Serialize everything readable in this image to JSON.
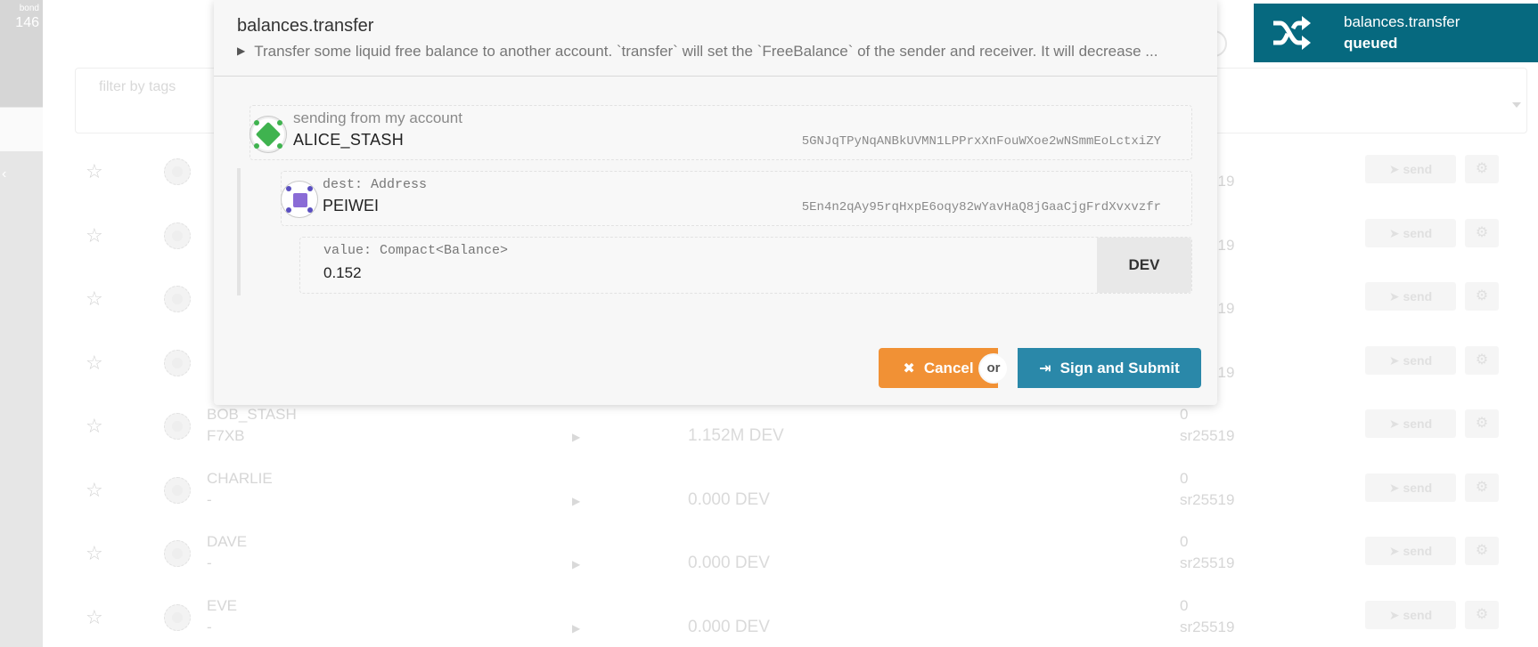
{
  "left_nav": {
    "top_small": "bond",
    "top_number": "146",
    "collapse_glyph": "‹"
  },
  "filter": {
    "placeholder": "filter by tags"
  },
  "accounts": [
    {
      "name": "",
      "address": "",
      "balance": "",
      "nonce": "",
      "crypto": "sr25519"
    },
    {
      "name": "",
      "address": "",
      "balance": "",
      "nonce": "",
      "crypto": "sr25519"
    },
    {
      "name": "",
      "address": "",
      "balance": "",
      "nonce": "",
      "crypto": "sr25519"
    },
    {
      "name": "",
      "address": "",
      "balance": "",
      "nonce": "",
      "crypto": "sr25519"
    },
    {
      "name": "BOB_STASH",
      "address": "F7XB",
      "balance": "1.152M DEV",
      "nonce": "0",
      "crypto": "sr25519"
    },
    {
      "name": "CHARLIE",
      "address": "-",
      "balance": "0.000 DEV",
      "nonce": "0",
      "crypto": "sr25519"
    },
    {
      "name": "DAVE",
      "address": "-",
      "balance": "0.000 DEV",
      "nonce": "0",
      "crypto": "sr25519"
    },
    {
      "name": "EVE",
      "address": "-",
      "balance": "0.000 DEV",
      "nonce": "0",
      "crypto": "sr25519"
    }
  ],
  "row_actions": {
    "send_label": "send"
  },
  "modal": {
    "title": "balances.transfer",
    "description": "Transfer some liquid free balance to another account. `transfer` will set the `FreeBalance` of the sender and receiver. It will decrease ...",
    "sender": {
      "label": "sending from my account",
      "name": "ALICE_STASH",
      "address": "5GNJqTPyNqANBkUVMN1LPPrxXnFouWXoe2wNSmmEoLctxiZY"
    },
    "dest": {
      "label": "dest: Address",
      "name": "PEIWEI",
      "address": "5En4n2qAy95rqHxpE6oqy82wYavHaQ8jGaaCjgFrdXvxvzfr"
    },
    "value": {
      "label": "value: Compact<Balance>",
      "amount": "0.152",
      "unit": "DEV"
    },
    "cancel_label": "Cancel",
    "or_label": "or",
    "submit_label": "Sign and Submit"
  },
  "toast": {
    "title": "balances.transfer",
    "status": "queued",
    "icon": "shuffle-icon",
    "color": "#06697f"
  },
  "colors": {
    "cancel": "#f19135",
    "submit": "#2a88a9"
  }
}
